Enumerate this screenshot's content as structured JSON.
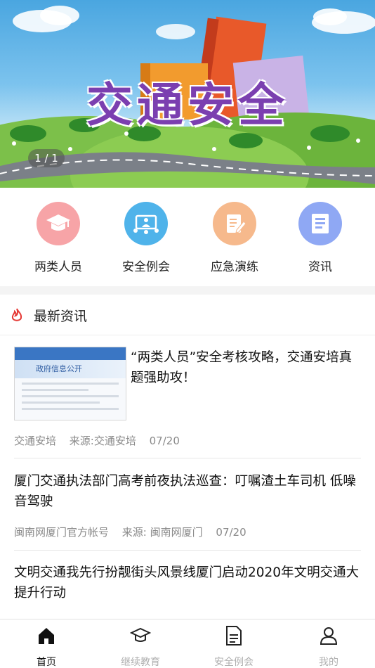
{
  "banner": {
    "title": "交通安全",
    "counter": "1 / 1"
  },
  "quick_menu": [
    {
      "label": "两类人员",
      "icon": "graduation-cap-icon",
      "color": "#f7a4a7"
    },
    {
      "label": "安全例会",
      "icon": "meeting-icon",
      "color": "#4fb3ea"
    },
    {
      "label": "应急演练",
      "icon": "document-edit-icon",
      "color": "#f6b98c"
    },
    {
      "label": "资讯",
      "icon": "news-icon",
      "color": "#8fa8f4"
    }
  ],
  "news_section": {
    "title": "最新资讯",
    "icon": "fire-icon",
    "accent": "#e53935"
  },
  "news": [
    {
      "title": "“两类人员”安全考核攻略，交通安培真题强助攻！",
      "author": "交通安培",
      "source": "来源:交通安培",
      "date": "07/20",
      "thumb_text": "政府信息公开"
    },
    {
      "title": "厦门交通执法部门高考前夜执法巡查：叮嘱渣土车司机 低噪音驾驶",
      "author": "闽南网厦门官方帐号",
      "source": "来源: 闽南网厦门",
      "date": "07/20"
    },
    {
      "title": "文明交通我先行扮靓街头风景线厦门启动2020年文明交通大提升行动"
    }
  ],
  "tabbar": [
    {
      "label": "首页",
      "icon": "home-icon",
      "active": true
    },
    {
      "label": "继续教育",
      "icon": "graduation-cap-icon",
      "active": false
    },
    {
      "label": "安全例会",
      "icon": "document-icon",
      "active": false
    },
    {
      "label": "我的",
      "icon": "user-icon",
      "active": false
    }
  ]
}
